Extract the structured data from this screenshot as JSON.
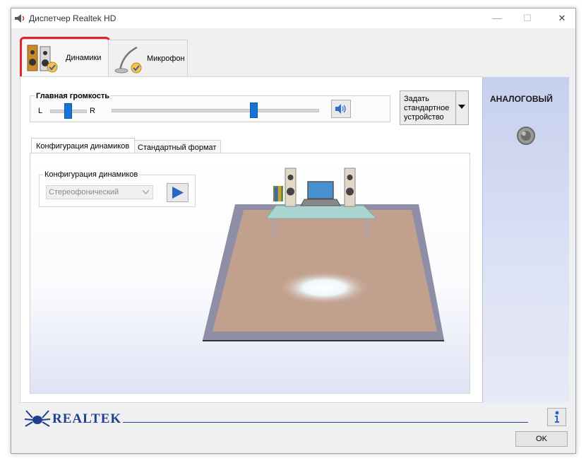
{
  "window": {
    "title": "Диспетчер Realtek HD",
    "controls": {
      "minimize": "—",
      "maximize": "☐",
      "close": "✕"
    }
  },
  "tabs": [
    {
      "label": "Динамики",
      "icon": "speakers-icon",
      "selected": true
    },
    {
      "label": "Микрофон",
      "icon": "microphone-icon",
      "selected": false
    }
  ],
  "volume": {
    "group_title": "Главная громкость",
    "balance_left": "L",
    "balance_right": "R",
    "balance_level": 0.5,
    "master_level": 0.69,
    "mute_icon": "speaker-volume-icon"
  },
  "default_device_button": {
    "label": "Задать стандартное устройство"
  },
  "subtabs": [
    {
      "label": "Конфигурация динамиков",
      "selected": true
    },
    {
      "label": "Стандартный формат",
      "selected": false
    }
  ],
  "speaker_config": {
    "group_title": "Конфигурация динамиков",
    "selected": "Стереофонический",
    "play_icon": "play-icon"
  },
  "connector_panel": {
    "title": "АНАЛОГОВЫЙ"
  },
  "footer": {
    "brand": "REALTEK",
    "ok_label": "OK",
    "info_icon": "info-icon"
  },
  "colors": {
    "accent_blue": "#1673d8",
    "floor": "#c2a08e",
    "highlight_red": "#e0252b",
    "panel_blue": "#c6d0ee"
  }
}
